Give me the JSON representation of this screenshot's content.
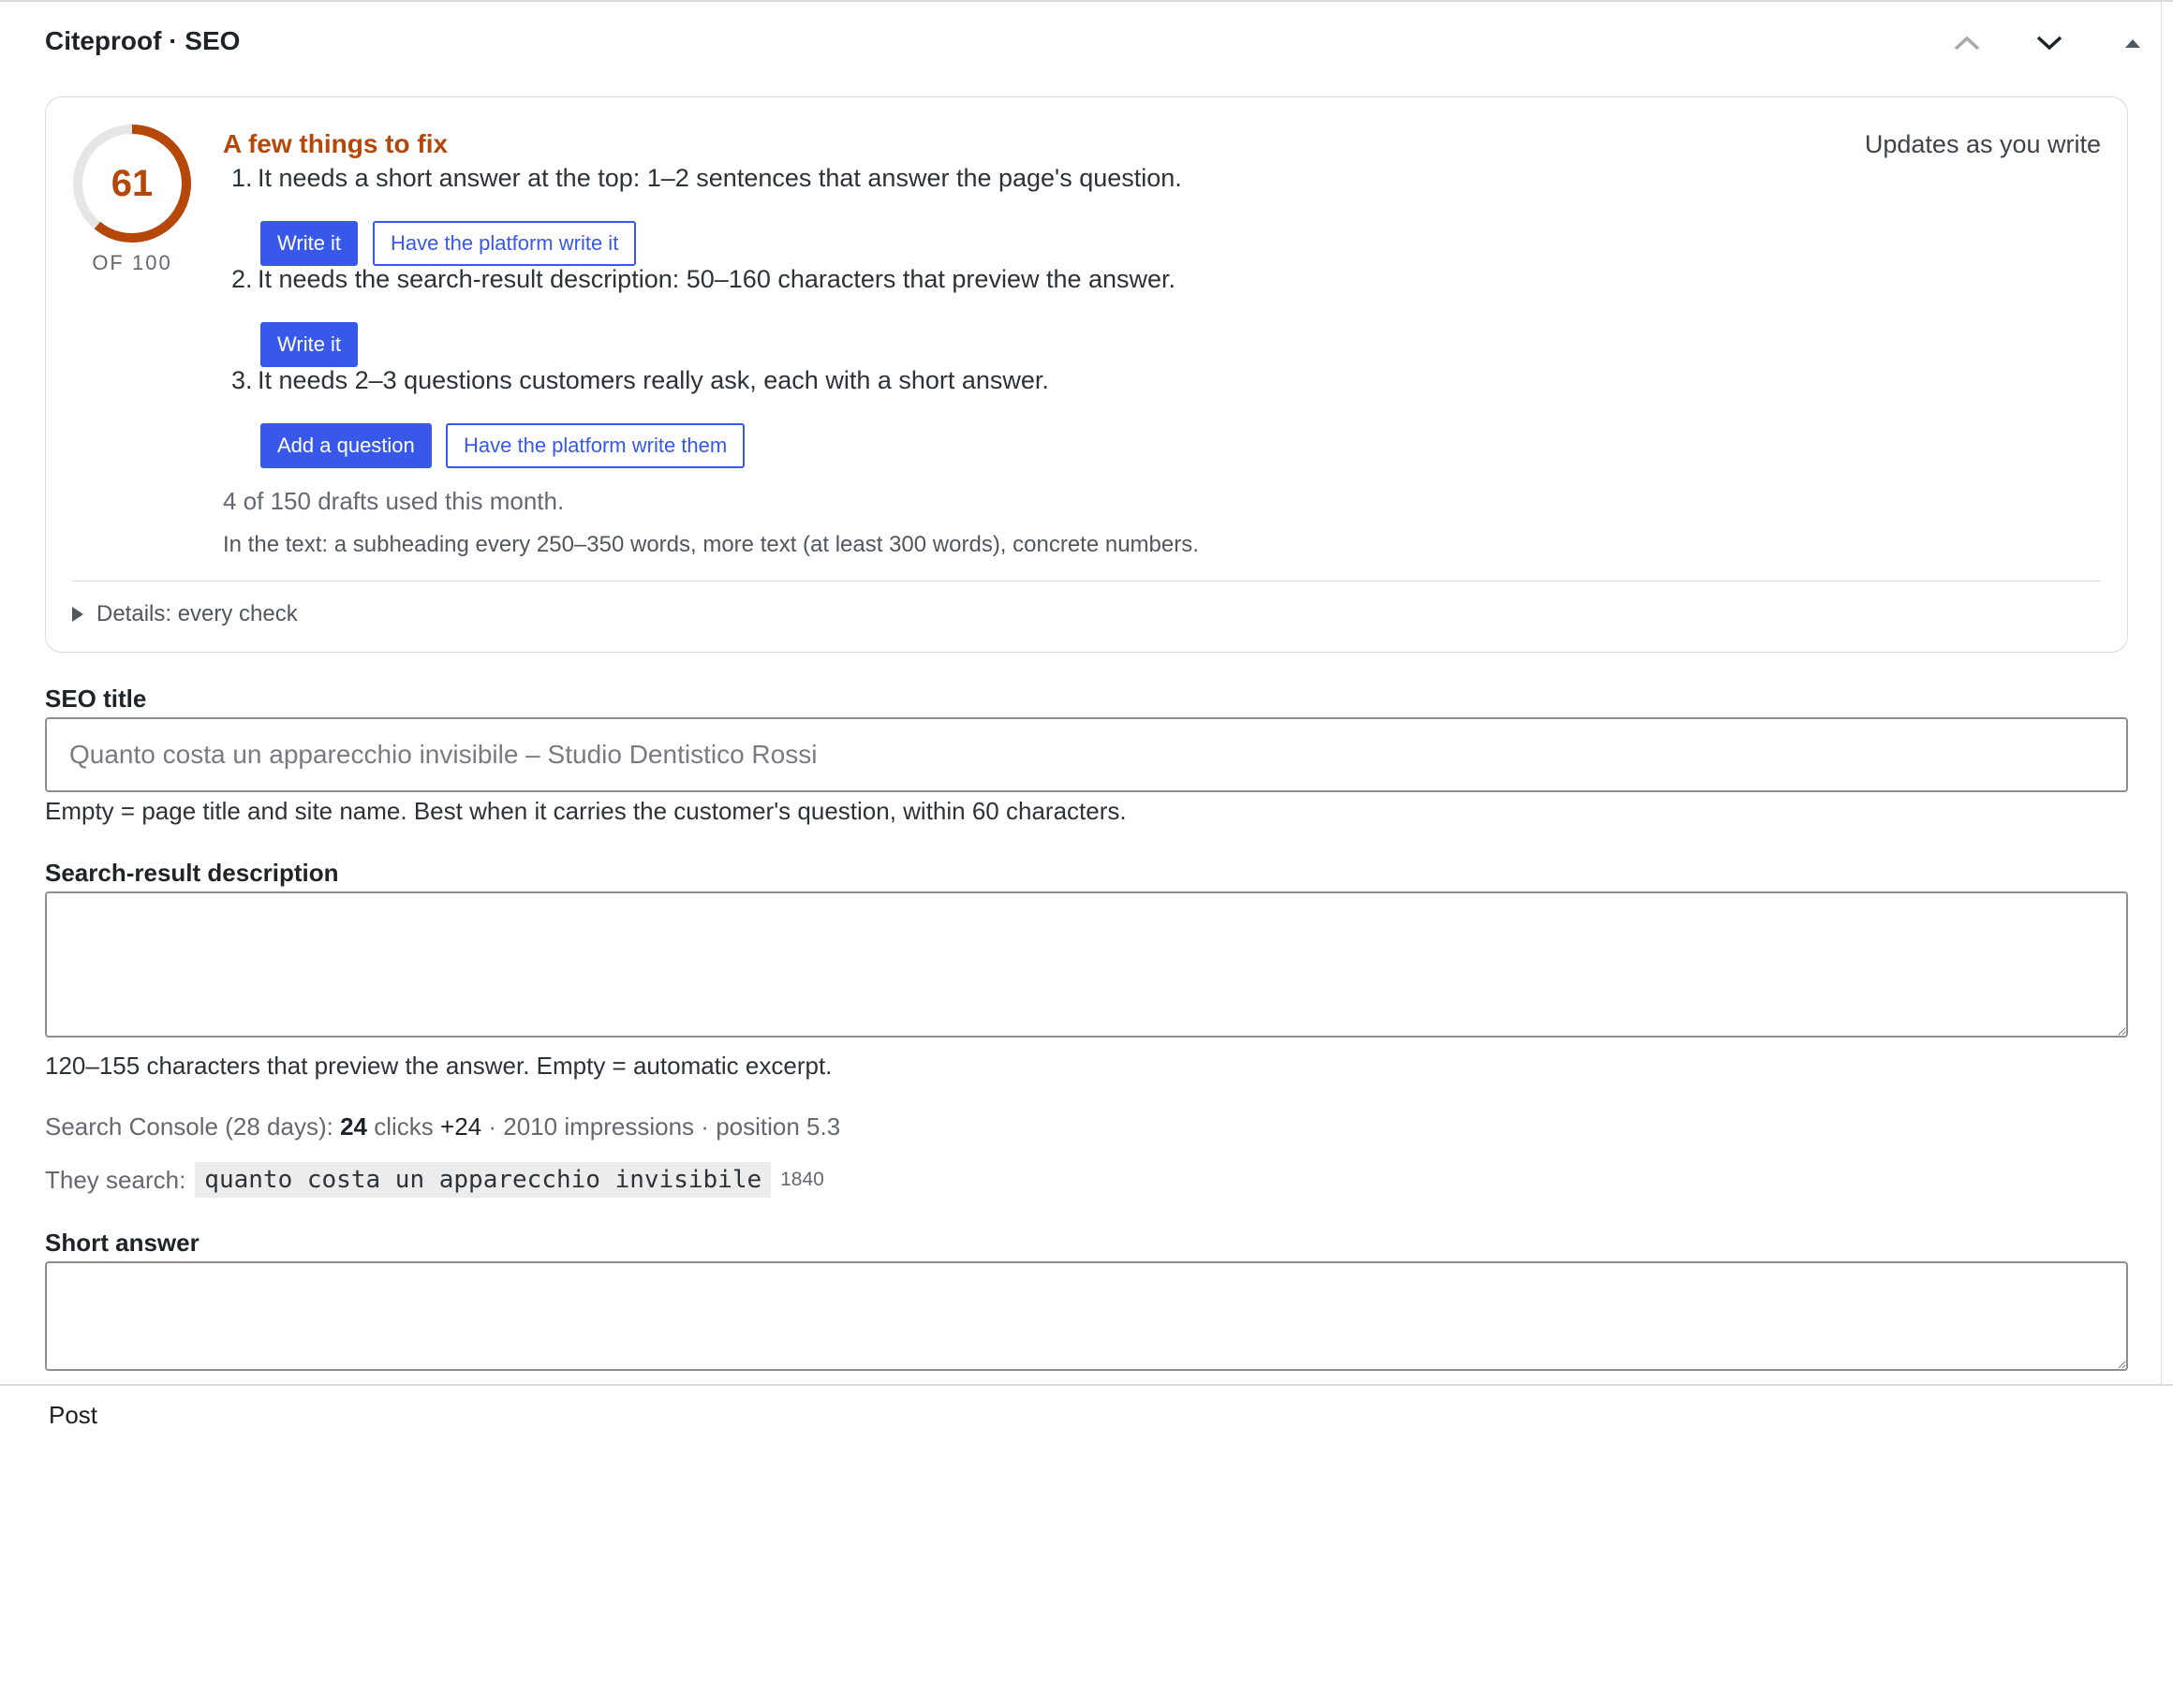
{
  "panel": {
    "title": "Citeproof · SEO",
    "move_up_icon": "chevron-up-icon",
    "move_down_icon": "chevron-down-icon",
    "toggle_icon": "caret-up-icon"
  },
  "score": {
    "value": "61",
    "of_label": "OF 100",
    "fraction": 0.61,
    "color": "#b54708",
    "status_title": "A few things to fix",
    "live_note": "Updates as you write"
  },
  "fixes": [
    {
      "number": "1.",
      "text": "It needs a short answer at the top: 1–2 sentences that answer the page's question.",
      "primary_label": "Write it",
      "secondary_label": "Have the platform write it"
    },
    {
      "number": "2.",
      "text": "It needs the search-result description: 50–160 characters that preview the answer.",
      "primary_label": "Write it"
    },
    {
      "number": "3.",
      "text": "It needs 2–3 questions customers really ask, each with a short answer.",
      "primary_label": "Add a question",
      "secondary_label": "Have the platform write them"
    }
  ],
  "drafts_usage": "4 of 150 drafts used this month.",
  "text_hint": "In the text: a subheading every 250–350 words, more text (at least 300 words), concrete numbers.",
  "details_label": "Details: every check",
  "seo_title": {
    "label": "SEO title",
    "value": "",
    "placeholder": "Quanto costa un apparecchio invisibile – Studio Dentistico Rossi",
    "help": "Empty = page title and site name. Best when it carries the customer's question, within 60 characters."
  },
  "description": {
    "label": "Search-result description",
    "value": "",
    "help": "120–155 characters that preview the answer. Empty = automatic excerpt."
  },
  "search_console": {
    "prefix": "Search Console (28 days):",
    "clicks": "24",
    "clicks_label": "clicks",
    "clicks_delta": "+24",
    "sep1": "·",
    "impressions": "2010 impressions",
    "sep2": "·",
    "position": "position 5.3",
    "they_search_label": "They search:",
    "query": "quanto costa un apparecchio invisibile",
    "query_count": "1840"
  },
  "short_answer": {
    "label": "Short answer",
    "value": ""
  },
  "footer": {
    "post_label": "Post"
  },
  "colors": {
    "accent": "#3858e9",
    "warning": "#b54708"
  }
}
